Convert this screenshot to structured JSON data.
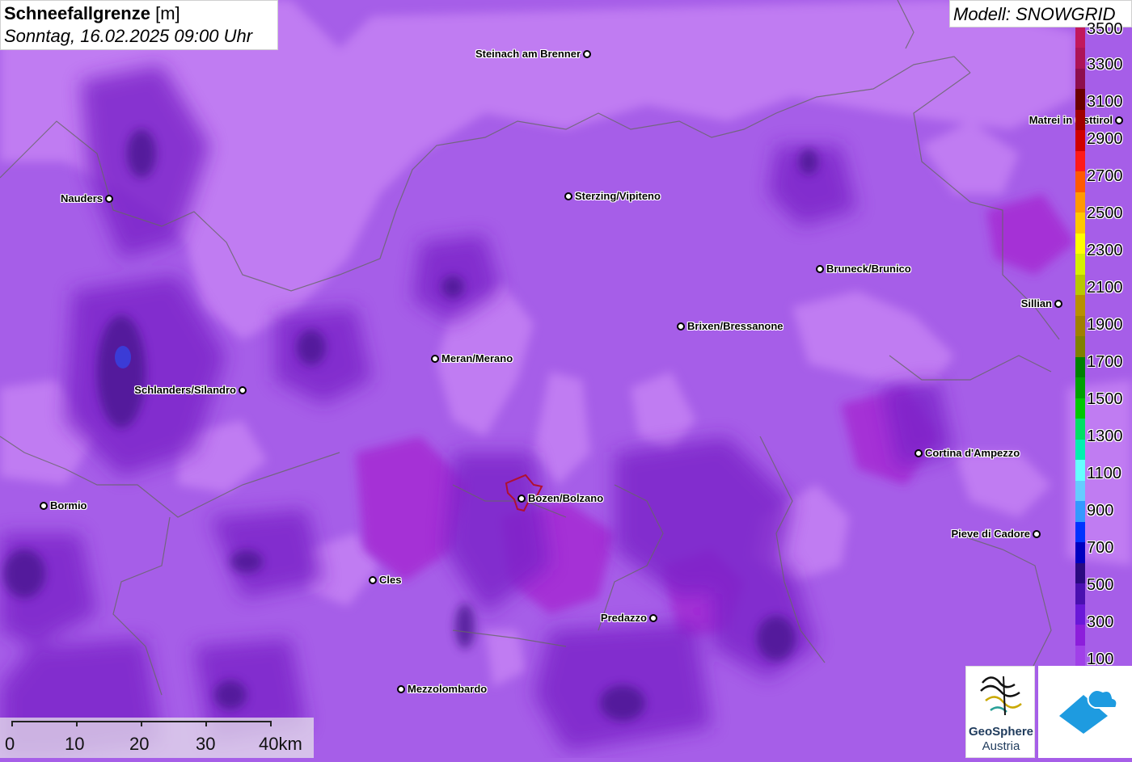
{
  "header": {
    "title_bold": "Schneefallgrenze",
    "title_unit": "[m]",
    "datetime": "Sonntag, 16.02.2025 09:00 Uhr",
    "model": "Modell: SNOWGRID"
  },
  "cities": [
    {
      "name": "Steinach am Brenner",
      "label_side": "left"
    },
    {
      "name": "Matrei in Osttirol",
      "label_side": "left"
    },
    {
      "name": "Nauders",
      "label_side": "left"
    },
    {
      "name": "Sterzing/Vipiteno",
      "label_side": "right"
    },
    {
      "name": "Bruneck/Brunico",
      "label_side": "right"
    },
    {
      "name": "Sillian",
      "label_side": "left"
    },
    {
      "name": "Brixen/Bressanone",
      "label_side": "right"
    },
    {
      "name": "Meran/Merano",
      "label_side": "right"
    },
    {
      "name": "Schlanders/Silandro",
      "label_side": "left"
    },
    {
      "name": "Cortina d'Ampezzo",
      "label_side": "right"
    },
    {
      "name": "Bormio",
      "label_side": "right"
    },
    {
      "name": "Bozen/Bolzano",
      "label_side": "right"
    },
    {
      "name": "Pieve di Cadore",
      "label_side": "left"
    },
    {
      "name": "Cles",
      "label_side": "right"
    },
    {
      "name": "Predazzo",
      "label_side": "left"
    },
    {
      "name": "Mezzolombardo",
      "label_side": "right"
    }
  ],
  "legend": {
    "labels": [
      "3500",
      "3300",
      "3100",
      "2900",
      "2700",
      "2500",
      "2300",
      "2100",
      "1900",
      "1700",
      "1500",
      "1300",
      "1100",
      "900",
      "700",
      "500",
      "300",
      "100"
    ],
    "colors": [
      "#c2185b",
      "#ad1457",
      "#8e0e4e",
      "#6a0000",
      "#a00000",
      "#d00000",
      "#ff1a1a",
      "#ff5a00",
      "#ff9a00",
      "#ffc800",
      "#ffff00",
      "#d6f000",
      "#b8c800",
      "#b89000",
      "#a08000",
      "#808000",
      "#008000",
      "#00a000",
      "#00c800",
      "#00e066",
      "#00f0b0",
      "#66ffff",
      "#66ccff",
      "#3399ff",
      "#0033ff",
      "#0000c0",
      "#2a0a80",
      "#4a10b0",
      "#6a18d8",
      "#8c1edb",
      "#a040e8"
    ]
  },
  "scale": {
    "labels": [
      "0",
      "10",
      "20",
      "30",
      "40km"
    ]
  },
  "logo": {
    "line1": "GeoSphere",
    "line2": "Austria"
  },
  "colors": {
    "base": "#a65ee8",
    "light": "#c07cf2",
    "mid": "#9a3de0",
    "magenta": "#a52bd3",
    "dark": "#7a22c8",
    "darkest": "#5a1ea0"
  }
}
